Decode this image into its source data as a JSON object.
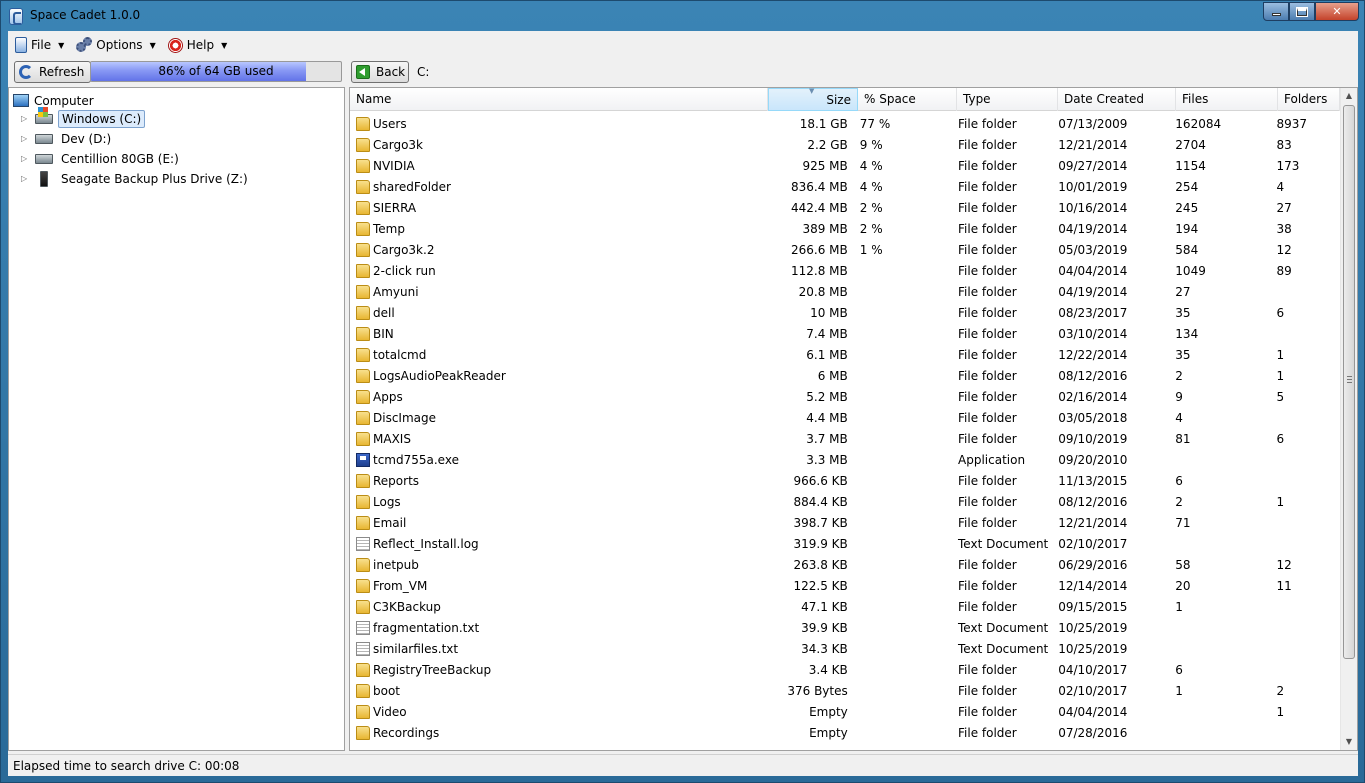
{
  "window": {
    "title": "Space Cadet 1.0.0"
  },
  "menu": [
    {
      "label": "File",
      "icon": "file-icon"
    },
    {
      "label": "Options",
      "icon": "gear-icon"
    },
    {
      "label": "Help",
      "icon": "lifebuoy-icon"
    }
  ],
  "toolbar": {
    "refresh_label": "Refresh",
    "usage_label": "86% of 64 GB used",
    "usage_fraction": 0.86,
    "back_label": "Back",
    "current_path": "C:"
  },
  "tree": {
    "root_label": "Computer",
    "drives": [
      {
        "label": "Windows (C:)",
        "selected": true,
        "icon": "windows-drive-icon"
      },
      {
        "label": "Dev (D:)",
        "selected": false,
        "icon": "hard-drive-icon"
      },
      {
        "label": "Centillion 80GB (E:)",
        "selected": false,
        "icon": "hard-drive-icon"
      },
      {
        "label": "Seagate Backup Plus Drive (Z:)",
        "selected": false,
        "icon": "external-drive-icon"
      }
    ]
  },
  "list": {
    "columns": [
      "Name",
      "Size",
      "% Space",
      "Type",
      "Date Created",
      "Files",
      "Folders"
    ],
    "rows": [
      {
        "icon": "folder",
        "name": "Users",
        "size": "18.1 GB",
        "pct": "77 %",
        "type": "File folder",
        "date": "07/13/2009",
        "files": "162084",
        "folders": "8937"
      },
      {
        "icon": "folder",
        "name": "Cargo3k",
        "size": "2.2 GB",
        "pct": "9 %",
        "type": "File folder",
        "date": "12/21/2014",
        "files": "2704",
        "folders": "83"
      },
      {
        "icon": "folder",
        "name": "NVIDIA",
        "size": "925 MB",
        "pct": "4 %",
        "type": "File folder",
        "date": "09/27/2014",
        "files": "1154",
        "folders": "173"
      },
      {
        "icon": "folder",
        "name": "sharedFolder",
        "size": "836.4 MB",
        "pct": "4 %",
        "type": "File folder",
        "date": "10/01/2019",
        "files": "254",
        "folders": "4"
      },
      {
        "icon": "folder",
        "name": "SIERRA",
        "size": "442.4 MB",
        "pct": "2 %",
        "type": "File folder",
        "date": "10/16/2014",
        "files": "245",
        "folders": "27"
      },
      {
        "icon": "folder",
        "name": "Temp",
        "size": "389 MB",
        "pct": "2 %",
        "type": "File folder",
        "date": "04/19/2014",
        "files": "194",
        "folders": "38"
      },
      {
        "icon": "folder",
        "name": "Cargo3k.2",
        "size": "266.6 MB",
        "pct": "1 %",
        "type": "File folder",
        "date": "05/03/2019",
        "files": "584",
        "folders": "12"
      },
      {
        "icon": "folder",
        "name": "2-click run",
        "size": "112.8 MB",
        "pct": "",
        "type": "File folder",
        "date": "04/04/2014",
        "files": "1049",
        "folders": "89"
      },
      {
        "icon": "folder",
        "name": "Amyuni",
        "size": "20.8 MB",
        "pct": "",
        "type": "File folder",
        "date": "04/19/2014",
        "files": "27",
        "folders": ""
      },
      {
        "icon": "folder",
        "name": "dell",
        "size": "10 MB",
        "pct": "",
        "type": "File folder",
        "date": "08/23/2017",
        "files": "35",
        "folders": "6"
      },
      {
        "icon": "folder",
        "name": "BIN",
        "size": "7.4 MB",
        "pct": "",
        "type": "File folder",
        "date": "03/10/2014",
        "files": "134",
        "folders": ""
      },
      {
        "icon": "folder",
        "name": "totalcmd",
        "size": "6.1 MB",
        "pct": "",
        "type": "File folder",
        "date": "12/22/2014",
        "files": "35",
        "folders": "1"
      },
      {
        "icon": "folder",
        "name": "LogsAudioPeakReader",
        "size": "6 MB",
        "pct": "",
        "type": "File folder",
        "date": "08/12/2016",
        "files": "2",
        "folders": "1"
      },
      {
        "icon": "folder",
        "name": "Apps",
        "size": "5.2 MB",
        "pct": "",
        "type": "File folder",
        "date": "02/16/2014",
        "files": "9",
        "folders": "5"
      },
      {
        "icon": "folder",
        "name": "DiscImage",
        "size": "4.4 MB",
        "pct": "",
        "type": "File folder",
        "date": "03/05/2018",
        "files": "4",
        "folders": ""
      },
      {
        "icon": "folder",
        "name": "MAXIS",
        "size": "3.7 MB",
        "pct": "",
        "type": "File folder",
        "date": "09/10/2019",
        "files": "81",
        "folders": "6"
      },
      {
        "icon": "app",
        "name": "tcmd755a.exe",
        "size": "3.3 MB",
        "pct": "",
        "type": "Application",
        "date": "09/20/2010",
        "files": "",
        "folders": ""
      },
      {
        "icon": "folder",
        "name": "Reports",
        "size": "966.6 KB",
        "pct": "",
        "type": "File folder",
        "date": "11/13/2015",
        "files": "6",
        "folders": ""
      },
      {
        "icon": "folder",
        "name": "Logs",
        "size": "884.4 KB",
        "pct": "",
        "type": "File folder",
        "date": "08/12/2016",
        "files": "2",
        "folders": "1"
      },
      {
        "icon": "folder",
        "name": "Email",
        "size": "398.7 KB",
        "pct": "",
        "type": "File folder",
        "date": "12/21/2014",
        "files": "71",
        "folders": ""
      },
      {
        "icon": "doc",
        "name": "Reflect_Install.log",
        "size": "319.9 KB",
        "pct": "",
        "type": "Text Document",
        "date": "02/10/2017",
        "files": "",
        "folders": ""
      },
      {
        "icon": "folder",
        "name": "inetpub",
        "size": "263.8 KB",
        "pct": "",
        "type": "File folder",
        "date": "06/29/2016",
        "files": "58",
        "folders": "12"
      },
      {
        "icon": "folder",
        "name": "From_VM",
        "size": "122.5 KB",
        "pct": "",
        "type": "File folder",
        "date": "12/14/2014",
        "files": "20",
        "folders": "11"
      },
      {
        "icon": "folder",
        "name": "C3KBackup",
        "size": "47.1 KB",
        "pct": "",
        "type": "File folder",
        "date": "09/15/2015",
        "files": "1",
        "folders": ""
      },
      {
        "icon": "doc",
        "name": "fragmentation.txt",
        "size": "39.9 KB",
        "pct": "",
        "type": "Text Document",
        "date": "10/25/2019",
        "files": "",
        "folders": ""
      },
      {
        "icon": "doc",
        "name": "similarfiles.txt",
        "size": "34.3 KB",
        "pct": "",
        "type": "Text Document",
        "date": "10/25/2019",
        "files": "",
        "folders": ""
      },
      {
        "icon": "folder",
        "name": "RegistryTreeBackup",
        "size": "3.4 KB",
        "pct": "",
        "type": "File folder",
        "date": "04/10/2017",
        "files": "6",
        "folders": ""
      },
      {
        "icon": "folder",
        "name": "boot",
        "size": "376 Bytes",
        "pct": "",
        "type": "File folder",
        "date": "02/10/2017",
        "files": "1",
        "folders": "2"
      },
      {
        "icon": "folder",
        "name": "Video",
        "size": "Empty",
        "pct": "",
        "type": "File folder",
        "date": "04/04/2014",
        "files": "",
        "folders": "1"
      },
      {
        "icon": "folder",
        "name": "Recordings",
        "size": "Empty",
        "pct": "",
        "type": "File folder",
        "date": "07/28/2016",
        "files": "",
        "folders": ""
      }
    ]
  },
  "status": {
    "text": "Elapsed time to search drive C: 00:08"
  }
}
